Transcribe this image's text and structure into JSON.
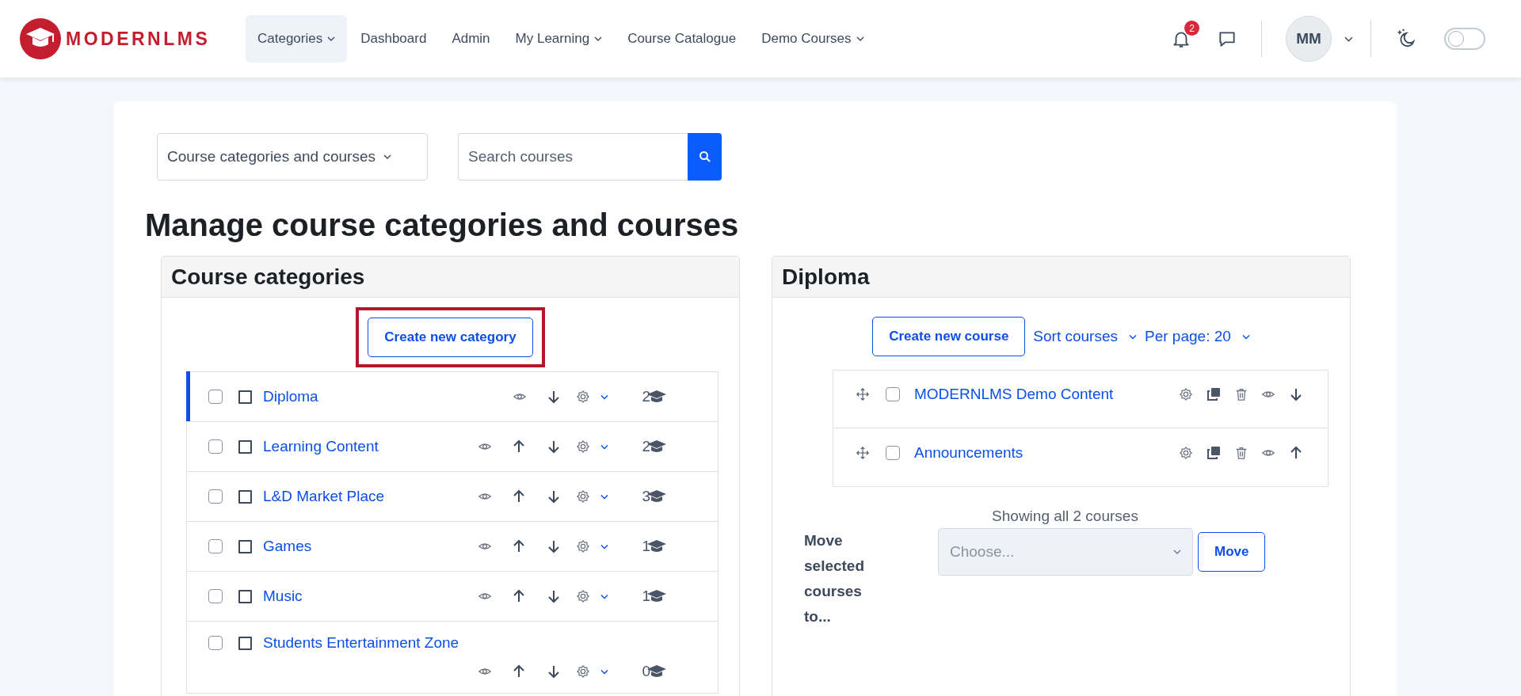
{
  "header": {
    "logo": {
      "text": "MODERNLMS"
    },
    "nav": [
      {
        "label": "Categories",
        "dropdown": true,
        "selected": true
      },
      {
        "label": "Dashboard",
        "dropdown": false,
        "selected": false
      },
      {
        "label": "Admin",
        "dropdown": false,
        "selected": false
      },
      {
        "label": "My Learning",
        "dropdown": true,
        "selected": false
      },
      {
        "label": "Course Catalogue",
        "dropdown": false,
        "selected": false
      },
      {
        "label": "Demo Courses",
        "dropdown": true,
        "selected": false
      }
    ],
    "notifications": {
      "count": "2"
    },
    "user": {
      "initials": "MM"
    },
    "dark_mode": {
      "on": false
    }
  },
  "toolbar": {
    "view_select": {
      "value": "Course categories and courses"
    },
    "search": {
      "placeholder": "Search courses"
    }
  },
  "title": "Manage course categories and courses",
  "categories_panel": {
    "title": "Course categories",
    "create_button": {
      "label": "Create new category",
      "highlighted": true
    },
    "items": [
      {
        "name": "Diploma",
        "selected": true,
        "checked": false,
        "move_up": false,
        "move_down": true,
        "count": "2"
      },
      {
        "name": "Learning Content",
        "selected": false,
        "checked": false,
        "move_up": true,
        "move_down": true,
        "count": "2"
      },
      {
        "name": "L&D Market Place",
        "selected": false,
        "checked": false,
        "move_up": true,
        "move_down": true,
        "count": "3"
      },
      {
        "name": "Games",
        "selected": false,
        "checked": false,
        "move_up": true,
        "move_down": true,
        "count": "1"
      },
      {
        "name": "Music",
        "selected": false,
        "checked": false,
        "move_up": true,
        "move_down": true,
        "count": "1"
      },
      {
        "name": "Students Entertainment Zone",
        "selected": false,
        "checked": false,
        "move_up": true,
        "move_down": true,
        "count": "0"
      }
    ]
  },
  "courses_panel": {
    "title": "Diploma",
    "create_button": {
      "label": "Create new course"
    },
    "sort": {
      "label": "Sort courses"
    },
    "per_page": {
      "label": "Per page: 20"
    },
    "courses": [
      {
        "name": "MODERNLMS Demo Content",
        "checked": false,
        "move_up": false,
        "move_down": true
      },
      {
        "name": "Announcements",
        "checked": false,
        "move_up": true,
        "move_down": false
      }
    ],
    "summary": "Showing all 2 courses",
    "move_form": {
      "label": "Move selected courses to...",
      "value": "Choose...",
      "disabled": true,
      "button": "Move"
    }
  }
}
